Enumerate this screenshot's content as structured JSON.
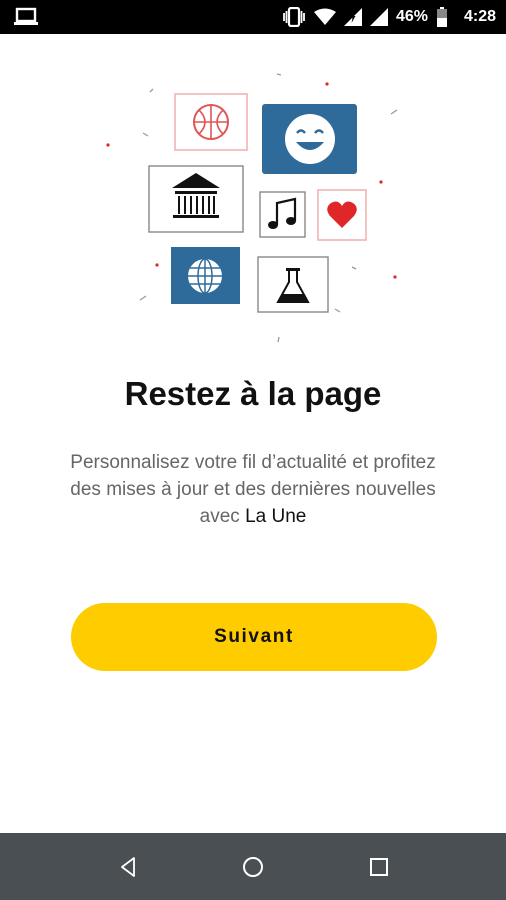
{
  "status_bar": {
    "battery_percent": "46%",
    "time": "4:28",
    "icons": [
      "laptop-icon",
      "vibrate-icon",
      "wifi-icon",
      "signal-icon",
      "signal-icon",
      "battery-icon"
    ]
  },
  "illustration": {
    "icons": [
      "basketball-icon",
      "smiley-icon",
      "bank-icon",
      "music-note-icon",
      "heart-icon",
      "globe-icon",
      "flask-icon"
    ]
  },
  "onboarding": {
    "title": "Restez à la page",
    "description_main": "Personnalisez votre fil d’actualité et profitez des mises à jour et des dernières nouvelles avec ",
    "brand": "La Une",
    "next_label": "Suivant"
  },
  "colors": {
    "accent": "#ffcc00",
    "tile_blue": "#2f6b9a",
    "heart_red": "#e02626",
    "nav_bar": "#4a4f54"
  },
  "nav_bar": {
    "buttons": [
      "back-icon",
      "home-icon",
      "recents-icon"
    ]
  }
}
